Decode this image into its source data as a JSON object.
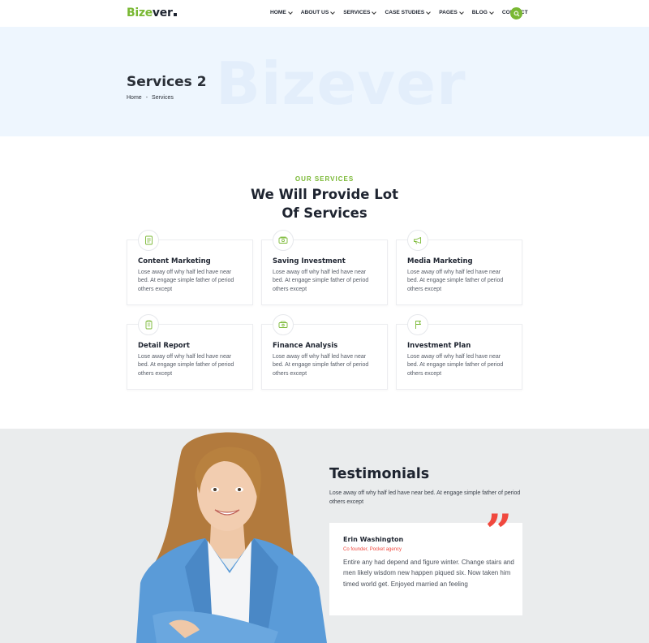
{
  "brand": {
    "part1": "Bize",
    "part2": "ver",
    "accent": "#79b833"
  },
  "nav": [
    {
      "label": "HOME",
      "dropdown": true
    },
    {
      "label": "ABOUT US",
      "dropdown": true
    },
    {
      "label": "SERVICES",
      "dropdown": true
    },
    {
      "label": "CASE STUDIES",
      "dropdown": true
    },
    {
      "label": "PAGES",
      "dropdown": true
    },
    {
      "label": "BLOG",
      "dropdown": true
    },
    {
      "label": "CONTACT",
      "dropdown": false
    }
  ],
  "search_icon": "search-icon",
  "banner": {
    "watermark": "Bizever",
    "title": "Services 2",
    "breadcrumb": {
      "home": "Home",
      "separator": "-",
      "current": "Services"
    }
  },
  "services": {
    "eyebrow": "OUR SERVICES",
    "heading": "We Will Provide Lot Of Services",
    "cards": [
      {
        "icon": "document-icon",
        "title": "Content Marketing",
        "desc": "Lose away off why half led have near bed. At engage simple father of period others except"
      },
      {
        "icon": "money-icon",
        "title": "Saving Investment",
        "desc": "Lose away off why half led have near bed. At engage simple father of period others except"
      },
      {
        "icon": "megaphone-icon",
        "title": "Media Marketing",
        "desc": "Lose away off why half led have near bed. At engage simple father of period others except"
      },
      {
        "icon": "report-icon",
        "title": "Detail Report",
        "desc": "Lose away off why half led have near bed. At engage simple father of period others except"
      },
      {
        "icon": "cash-icon",
        "title": "Finance Analysis",
        "desc": "Lose away off why half led have near bed. At engage simple father of period others except"
      },
      {
        "icon": "flag-icon",
        "title": "Investment Plan",
        "desc": "Lose away off why half led have near bed. At engage simple father of period others except"
      }
    ]
  },
  "testimonials": {
    "title": "Testimonials",
    "subtitle": "Lose away off why half led have near bed. At engage simple father of period others except",
    "quote_mark": "”",
    "quote_color": "#f0483e",
    "item": {
      "name": "Erin Washington",
      "role": "Co founder, Pocket agency",
      "text": "Entire any had depend and figure winter. Change stairs and men likely wisdom new happen piqued six. Now taken him timed world get. Enjoyed married an feeling"
    }
  }
}
